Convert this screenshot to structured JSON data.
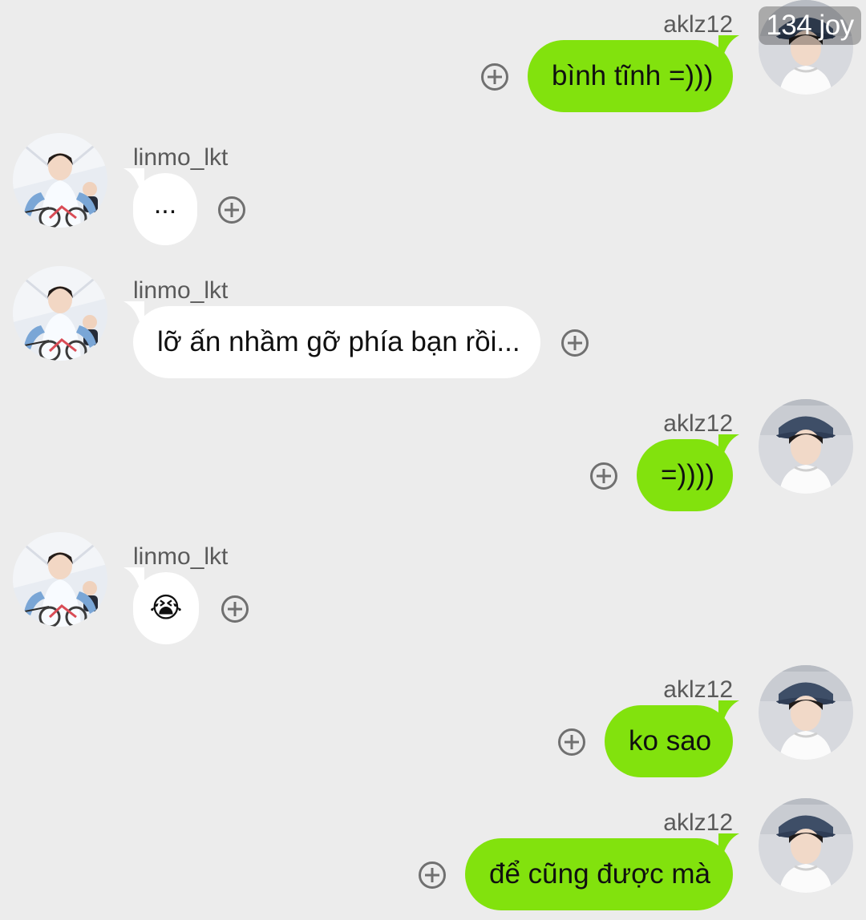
{
  "watermark": "134 joy",
  "colors": {
    "background": "#ececec",
    "self_bubble": "#82e20d",
    "other_bubble": "#ffffff",
    "username": "#5a5a5a",
    "add_icon": "#707070"
  },
  "messages": [
    {
      "sender": "aklz12",
      "side": "self",
      "text": "bình tĩnh =)))"
    },
    {
      "sender": "linmo_lkt",
      "side": "other",
      "text": "..."
    },
    {
      "sender": "linmo_lkt",
      "side": "other",
      "text": "lỡ ấn nhầm gỡ phía bạn rồi..."
    },
    {
      "sender": "aklz12",
      "side": "self",
      "text": "=))))"
    },
    {
      "sender": "linmo_lkt",
      "side": "other",
      "text": "😭"
    },
    {
      "sender": "aklz12",
      "side": "self",
      "text": "ko sao"
    },
    {
      "sender": "aklz12",
      "side": "self",
      "text": "để cũng được mà"
    }
  ],
  "icons": {
    "reaction_add": "add-circle-icon",
    "self_avatar": "self-avatar",
    "other_avatar": "other-avatar"
  }
}
